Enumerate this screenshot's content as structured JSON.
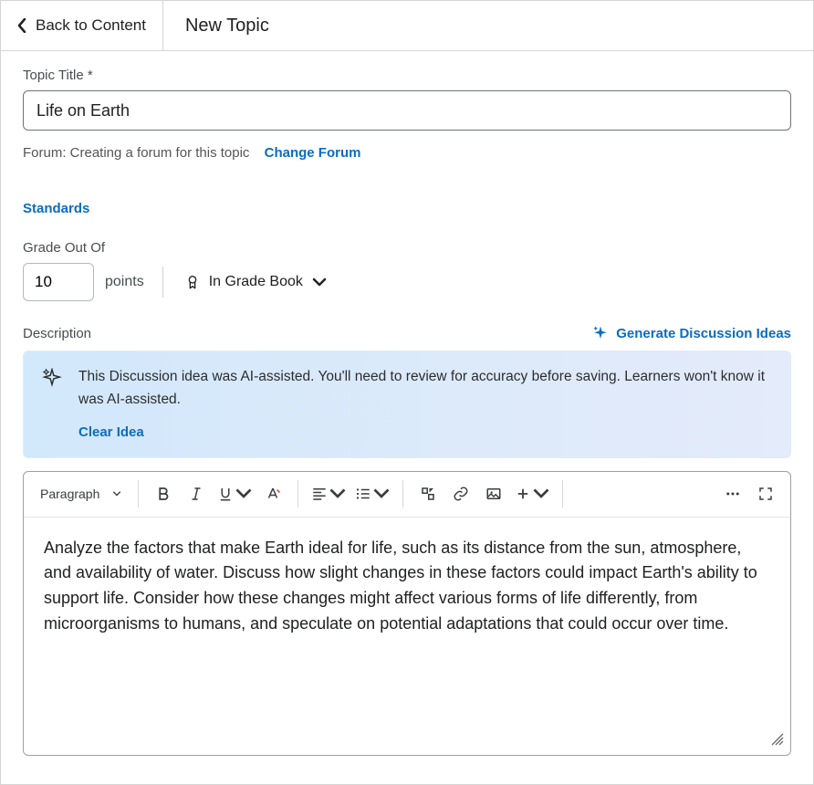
{
  "header": {
    "back_label": "Back to Content",
    "page_title": "New Topic"
  },
  "fields": {
    "topic_title_label": "Topic Title *",
    "topic_title_value": "Life on Earth",
    "forum_prefix": "Forum: Creating a forum for this topic",
    "change_forum_label": "Change Forum",
    "standards_label": "Standards",
    "grade_label": "Grade Out Of",
    "grade_value": "10",
    "points_label": "points",
    "gradebook_label": "In Grade Book",
    "description_label": "Description",
    "generate_ideas_label": "Generate Discussion Ideas"
  },
  "ai_banner": {
    "message": "This Discussion idea was AI-assisted. You'll need to review for accuracy before saving. Learners won't know it was AI-assisted.",
    "clear_label": "Clear Idea"
  },
  "editor": {
    "paragraph_label": "Paragraph",
    "body_text": "Analyze the factors that make Earth ideal for life, such as its distance from the sun, atmosphere, and availability of water. Discuss how slight changes in these factors could impact Earth's ability to support life. Consider how these changes might affect various forms of life differently, from microorganisms to humans, and speculate on potential adaptations that could occur over time."
  }
}
